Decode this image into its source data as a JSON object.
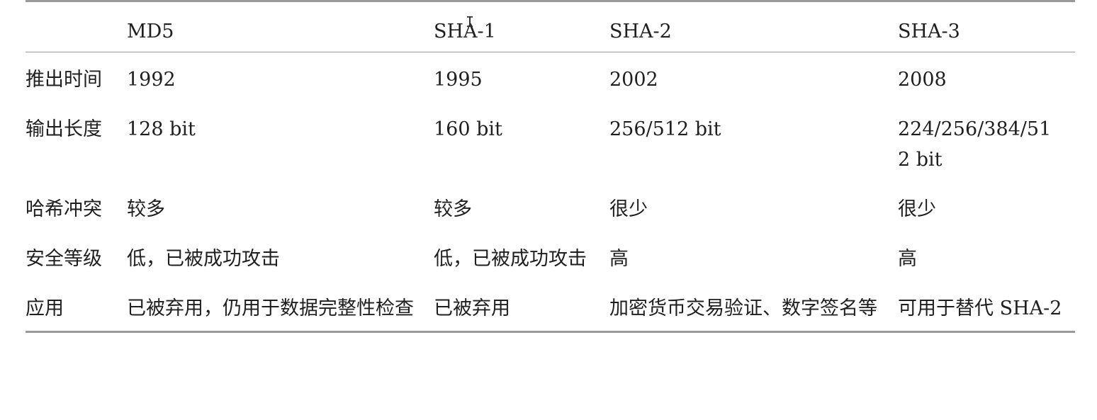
{
  "table": {
    "headers": [
      "",
      "MD5",
      "SHA-1",
      "SHA-2",
      "SHA-3"
    ],
    "rows": [
      {
        "label": "推出时间",
        "cells": [
          "1992",
          "1995",
          "2002",
          "2008"
        ]
      },
      {
        "label": "输出长度",
        "cells": [
          "128 bit",
          "160 bit",
          "256/512 bit",
          "224/256/384/512 bit"
        ]
      },
      {
        "label": "哈希冲突",
        "cells": [
          "较多",
          "较多",
          "很少",
          "很少"
        ]
      },
      {
        "label": "安全等级",
        "cells": [
          "低，已被成功攻击",
          "低，已被成功攻击",
          "高",
          "高"
        ]
      },
      {
        "label": "应用",
        "cells": [
          "已被弃用，仍用于数据完整性检查",
          "已被弃用",
          "加密货币交易验证、数字签名等",
          "可用于替代 SHA-2"
        ]
      }
    ]
  },
  "cursor": {
    "icon": "text-cursor-icon",
    "glyph": "I"
  }
}
